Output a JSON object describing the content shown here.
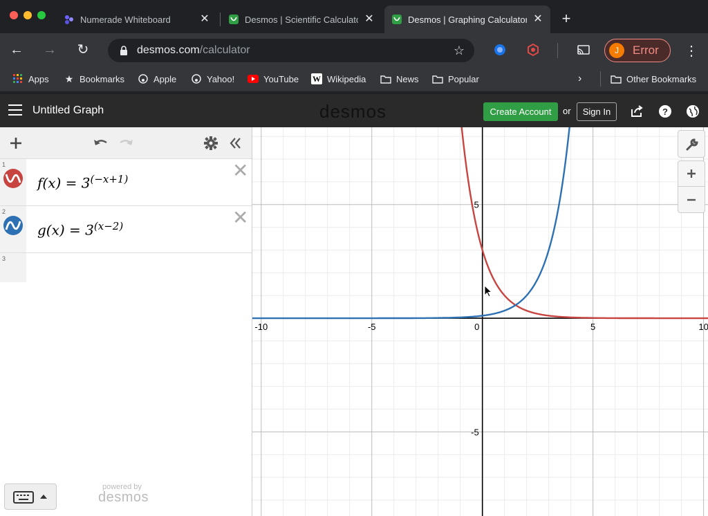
{
  "browser": {
    "tabs": [
      {
        "title": "Numerade Whiteboard",
        "favicon": "numerade-icon"
      },
      {
        "title": "Desmos | Scientific Calculator",
        "favicon": "desmos-icon"
      },
      {
        "title": "Desmos | Graphing Calculator",
        "favicon": "desmos-icon",
        "active": true
      }
    ],
    "url_host": "desmos.com",
    "url_path": "/calculator",
    "profile_initial": "J",
    "profile_label": "Error",
    "bookmarks": [
      "Apps",
      "Bookmarks",
      "Apple",
      "Yahoo!",
      "YouTube",
      "Wikipedia",
      "News",
      "Popular"
    ],
    "other_bookmarks": "Other Bookmarks"
  },
  "desmos": {
    "graph_title": "Untitled Graph",
    "brand": "desmos",
    "create_account": "Create Account",
    "or": "or",
    "sign_in": "Sign In",
    "powered_by": "powered by",
    "powered_logo": "desmos",
    "expressions": [
      {
        "index": "1",
        "lhs": "f(x) = 3",
        "exponent": "(−x+1)",
        "color": "#c74440"
      },
      {
        "index": "2",
        "lhs": "g(x) = 3",
        "exponent": "(x−2)",
        "color": "#2d70b3"
      },
      {
        "index": "3"
      }
    ]
  },
  "chart_data": {
    "type": "line",
    "xlim": [
      -10.4,
      10.2
    ],
    "ylim": [
      -8.7,
      8.4
    ],
    "x_ticks": [
      {
        "value": -10,
        "label": "-10"
      },
      {
        "value": -5,
        "label": "-5"
      },
      {
        "value": 0,
        "label": "0"
      },
      {
        "value": 5,
        "label": "5"
      },
      {
        "value": 10,
        "label": "10"
      }
    ],
    "y_ticks": [
      {
        "value": 5,
        "label": "5"
      },
      {
        "value": -5,
        "label": "-5"
      }
    ],
    "grid": true,
    "series": [
      {
        "name": "f(x) = 3^(−x+1)",
        "color": "#c74440",
        "base": 3,
        "a": -1,
        "b": 1
      },
      {
        "name": "g(x) = 3^(x−2)",
        "color": "#2d70b3",
        "base": 3,
        "a": 1,
        "b": -2
      }
    ]
  }
}
